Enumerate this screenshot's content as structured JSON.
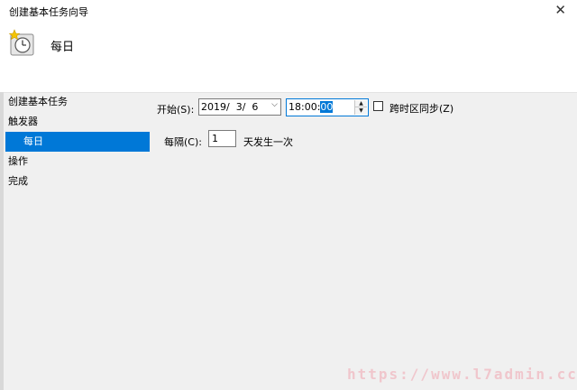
{
  "window": {
    "title": "创建基本任务向导",
    "close_glyph": "✕"
  },
  "header": {
    "icon": "clock-icon",
    "heading": "每日"
  },
  "nav": {
    "items": [
      {
        "label": "创建基本任务",
        "selected": false
      },
      {
        "label": "触发器",
        "selected": false
      },
      {
        "label": "每日",
        "selected": true
      },
      {
        "label": "操作",
        "selected": false
      },
      {
        "label": "完成",
        "selected": false
      }
    ]
  },
  "form": {
    "start_label": "开始(S):",
    "start_date": "2019/  3/  6",
    "start_time_prefix": "18:00:",
    "start_time_selected": "00",
    "sync_label": "跨时区同步(Z)",
    "sync_checked": false,
    "interval_label": "每隔(C):",
    "interval_value": "1",
    "interval_suffix": "天发生一次"
  },
  "watermark": "https://www.l7admin.cc",
  "colors": {
    "selection": "#0078d7",
    "panel": "#f0f0f0",
    "header": "#ffffff"
  }
}
